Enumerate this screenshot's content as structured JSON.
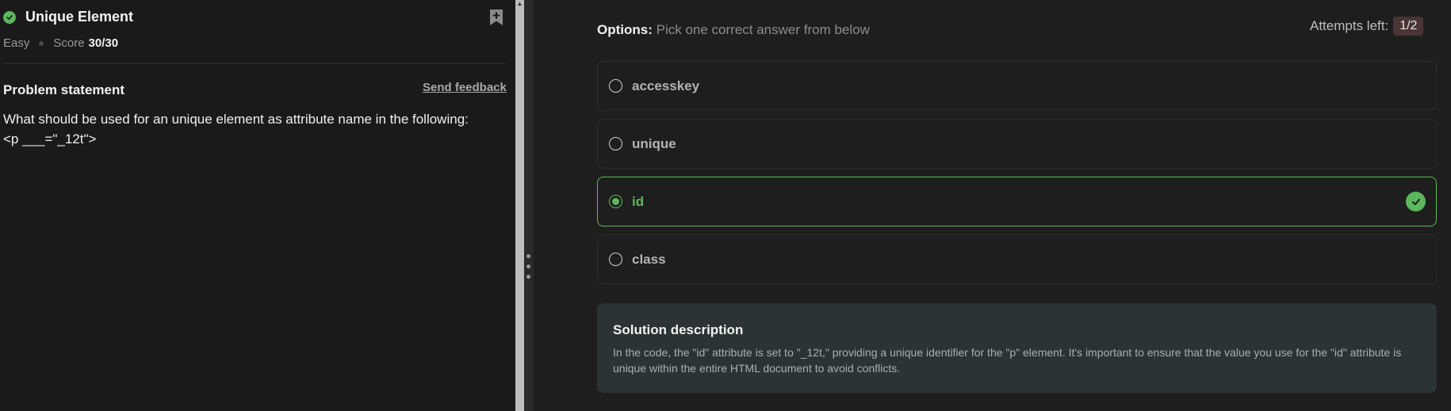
{
  "problem": {
    "title": "Unique Element",
    "difficulty": "Easy",
    "score_label": "Score",
    "score_value": "30/30",
    "statement_label": "Problem statement",
    "feedback_link": "Send feedback",
    "statement_line1": "What should be used for an unique element as attribute name in the following:",
    "statement_line2": "<p ___=\"_12t\">"
  },
  "options": {
    "heading_bold": "Options:",
    "heading_text": " Pick one correct answer from below",
    "attempts_label": "Attempts left:",
    "attempts_value": "1/2",
    "items": [
      {
        "label": "accesskey",
        "selected": false
      },
      {
        "label": "unique",
        "selected": false
      },
      {
        "label": "id",
        "selected": true,
        "correct": true
      },
      {
        "label": "class",
        "selected": false
      }
    ]
  },
  "solution": {
    "title": "Solution description",
    "body": "In the code, the \"id\" attribute is set to \"_12t,\" providing a unique identifier for the \"p\" element. It's important to ensure that the value you use for the \"id\" attribute is unique within the entire HTML document to avoid conflicts."
  },
  "colors": {
    "accent_green": "#5cb85c",
    "attempts_badge_bg": "#4a3436",
    "solution_bg": "#2b3334"
  },
  "icons": {
    "status": "check-circle-icon",
    "bookmark": "bookmark-plus-icon",
    "correct": "check-circle-icon"
  }
}
